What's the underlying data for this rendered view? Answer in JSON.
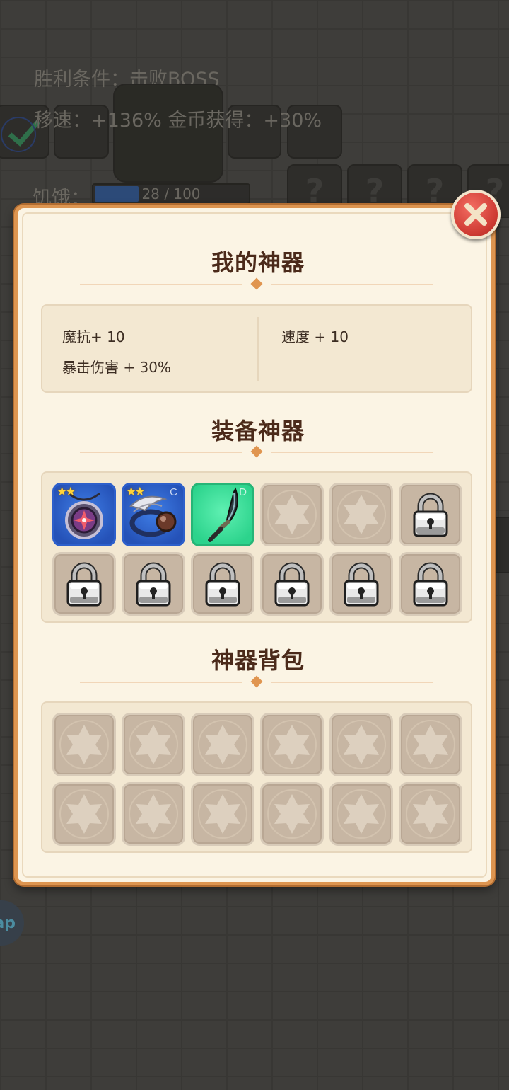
{
  "background": {
    "win_condition": "胜利条件：击败BOSS",
    "buff_line": "移速：+136%  金币获得：+30%",
    "hunger_label": "饥饿：",
    "hunger_value": "28 / 100",
    "hunger_fraction": 0.28,
    "unknown_mark": "?",
    "app_bubble_text": "ap"
  },
  "dialog": {
    "title": "我的神器",
    "stats": {
      "left": [
        "魔抗+ 10",
        "暴击伤害 + 30%"
      ],
      "right": [
        "速度 + 10"
      ]
    },
    "equip_section": {
      "title": "装备神器",
      "slots": [
        {
          "state": "item",
          "name": "amulet",
          "rarity": "blue",
          "stars": 2,
          "grade": ""
        },
        {
          "state": "item",
          "name": "winged-ring",
          "rarity": "blue",
          "stars": 2,
          "grade": "C"
        },
        {
          "state": "item",
          "name": "curved-blade",
          "rarity": "green",
          "stars": 0,
          "grade": "D"
        },
        {
          "state": "empty"
        },
        {
          "state": "empty"
        },
        {
          "state": "locked"
        },
        {
          "state": "locked"
        },
        {
          "state": "locked"
        },
        {
          "state": "locked"
        },
        {
          "state": "locked"
        },
        {
          "state": "locked"
        },
        {
          "state": "locked"
        }
      ]
    },
    "bag_section": {
      "title": "神器背包",
      "slot_count": 12
    }
  },
  "colors": {
    "panel_border": "#dd9550",
    "close_button": "#cf3c34",
    "rarity_blue": "#2552b8",
    "rarity_green": "#2cd38c"
  },
  "icons": {
    "close": "close-icon",
    "locked": "lock-icon",
    "empty": "star-emblem-icon"
  }
}
